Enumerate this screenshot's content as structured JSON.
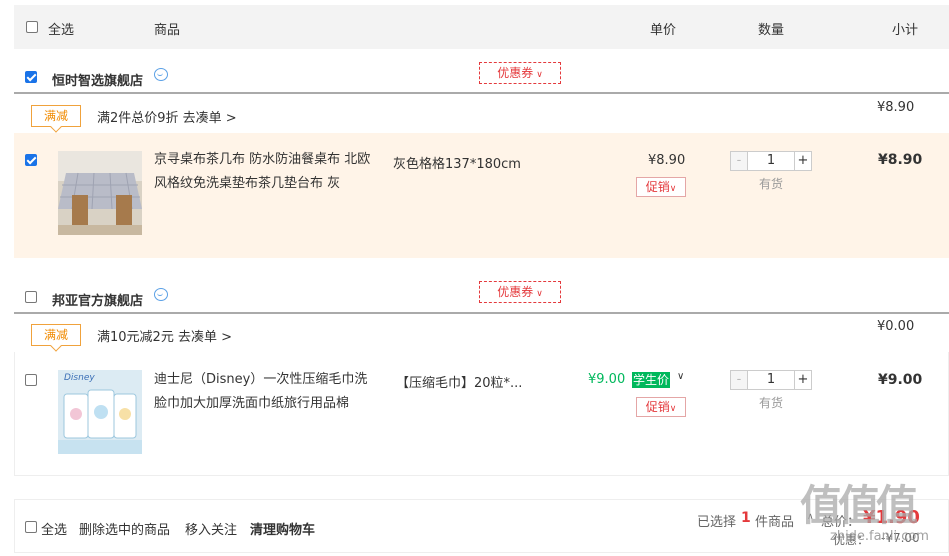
{
  "header": {
    "select_all": "全选",
    "col_product": "商品",
    "col_price": "单价",
    "col_qty": "数量",
    "col_subtotal": "小计"
  },
  "stores": [
    {
      "name": "恒时智选旗舰店",
      "checked": true,
      "coupon_label": "优惠券",
      "promo": {
        "tag": "满减",
        "text": "满2件总价9折 去凑单 >",
        "amount": "¥8.90"
      },
      "items": [
        {
          "checked": true,
          "title": "京寻桌布茶几布 防水防油餐桌布 北欧风格纹免洗桌垫布茶几垫台布 灰",
          "spec": "灰色格格137*180cm",
          "price": "¥8.90",
          "promo_select": "促销",
          "qty": "1",
          "stock": "有货",
          "subtotal": "¥8.90"
        }
      ]
    },
    {
      "name": "邦亚官方旗舰店",
      "checked": false,
      "coupon_label": "优惠券",
      "promo": {
        "tag": "满减",
        "text": "满10元减2元 去凑单 >",
        "amount": "¥0.00"
      },
      "items": [
        {
          "checked": false,
          "title": "迪士尼（Disney）一次性压缩毛巾洗脸巾加大加厚洗面巾纸旅行用品棉",
          "spec": "【压缩毛巾】20粒*...",
          "price": "¥9.00",
          "student_badge": "学生价",
          "promo_select": "促销",
          "qty": "1",
          "stock": "有货",
          "subtotal": "¥9.00",
          "thumb_brand": "Disney"
        }
      ]
    }
  ],
  "footer": {
    "select_all": "全选",
    "delete_selected": "删除选中的商品",
    "move_to_follow": "移入关注",
    "clear_cart": "清理购物车",
    "selected_prefix": "已选择",
    "selected_count": "1",
    "selected_suffix": "件商品",
    "total_label": "总价：",
    "total_amount": "¥1.90",
    "discount_label": "优惠：",
    "discount_amount": "-¥7.00"
  },
  "watermark": {
    "big": "值",
    "url": "zhide.fanli.com"
  },
  "colors": {
    "accent_red": "#e4393c",
    "promo_orange": "#f08a00",
    "student_green": "#00b85c",
    "checkbox_blue": "#1a73e8"
  }
}
